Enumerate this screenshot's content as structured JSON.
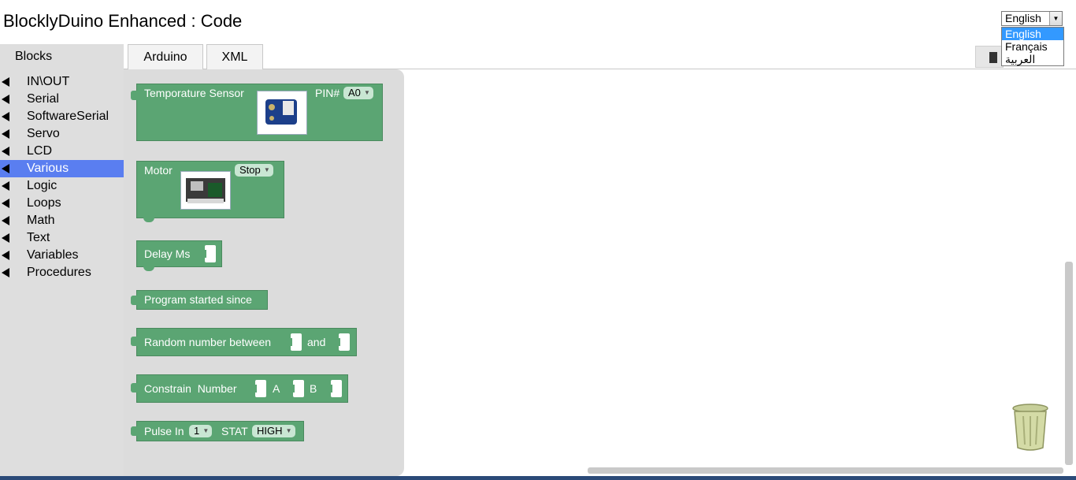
{
  "app": {
    "title": "BlocklyDuino Enhanced : Code"
  },
  "language": {
    "selected": "English",
    "options": [
      "English",
      "Français",
      "العربية"
    ]
  },
  "tabs": [
    {
      "label": "Arduino"
    },
    {
      "label": "XML"
    }
  ],
  "sidebar": {
    "header": "Blocks",
    "categories": [
      {
        "label": "IN\\OUT"
      },
      {
        "label": "Serial"
      },
      {
        "label": "SoftwareSerial"
      },
      {
        "label": "Servo"
      },
      {
        "label": "LCD"
      },
      {
        "label": "Various",
        "selected": true
      },
      {
        "label": "Logic"
      },
      {
        "label": "Loops"
      },
      {
        "label": "Math"
      },
      {
        "label": "Text"
      },
      {
        "label": "Variables"
      },
      {
        "label": "Procedures"
      }
    ]
  },
  "flyout": {
    "temperature": {
      "label": "Temporature Sensor",
      "pin_label": "PIN#",
      "pin_value": "A0"
    },
    "motor": {
      "label": "Motor",
      "value": "Stop"
    },
    "delay": {
      "label": "Delay Ms"
    },
    "program_started": {
      "label": "Program started since"
    },
    "random": {
      "label": "Random number between",
      "and_label": "and"
    },
    "constrain": {
      "label": "Constrain  Number",
      "a_label": "A",
      "b_label": "B"
    },
    "pulse": {
      "label": "Pulse In",
      "pin_value": "1",
      "stat_label": "STAT",
      "stat_value": "HIGH"
    }
  },
  "colors": {
    "block_green": "#5ba573",
    "selected_category": "#5a7ef0",
    "panel_gray": "#dedede"
  }
}
